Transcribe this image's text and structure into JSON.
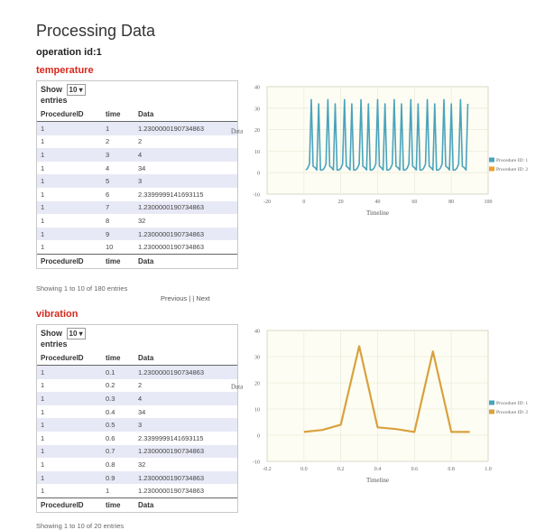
{
  "page": {
    "title": "Processing Data",
    "operation_label": "operation id:1"
  },
  "sections": [
    {
      "name": "temperature",
      "show_label": "Show",
      "entries_count": "10",
      "entries_label": "entries",
      "columns": [
        "ProcedureID",
        "time",
        "Data"
      ],
      "rows": [
        [
          "1",
          "1",
          "1.2300000190734863"
        ],
        [
          "1",
          "2",
          "2"
        ],
        [
          "1",
          "3",
          "4"
        ],
        [
          "1",
          "4",
          "34"
        ],
        [
          "1",
          "5",
          "3"
        ],
        [
          "1",
          "6",
          "2.3399999141693115"
        ],
        [
          "1",
          "7",
          "1.2300000190734863"
        ],
        [
          "1",
          "8",
          "32"
        ],
        [
          "1",
          "9",
          "1.2300000190734863"
        ],
        [
          "1",
          "10",
          "1.2300000190734863"
        ]
      ],
      "info": "Showing 1 to 10 of 180 entries",
      "pager": "Previous |  | Next"
    },
    {
      "name": "vibration",
      "show_label": "Show",
      "entries_count": "10",
      "entries_label": "entries",
      "columns": [
        "ProcedureID",
        "time",
        "Data"
      ],
      "rows": [
        [
          "1",
          "0.1",
          "1.2300000190734863"
        ],
        [
          "1",
          "0.2",
          "2"
        ],
        [
          "1",
          "0.3",
          "4"
        ],
        [
          "1",
          "0.4",
          "34"
        ],
        [
          "1",
          "0.5",
          "3"
        ],
        [
          "1",
          "0.6",
          "2.3399999141693115"
        ],
        [
          "1",
          "0.7",
          "1.2300000190734863"
        ],
        [
          "1",
          "0.8",
          "32"
        ],
        [
          "1",
          "0.9",
          "1.2300000190734863"
        ],
        [
          "1",
          "1",
          "1.2300000190734863"
        ]
      ],
      "info": "Showing 1 to 10 of 20 entries",
      "pager": ""
    }
  ],
  "chart_data": [
    {
      "type": "line",
      "xlabel": "Timeline",
      "ylabel": "Data",
      "xlim": [
        -20,
        100
      ],
      "ylim": [
        -10,
        40
      ],
      "xticks": [
        "-20",
        "0",
        "20",
        "40",
        "60",
        "80",
        "100"
      ],
      "yticks": [
        "-10",
        "0",
        "10",
        "20",
        "30",
        "40"
      ],
      "legend": "right",
      "series": [
        {
          "name": "Procedure ID: 1",
          "color": "#4aa3bd",
          "pattern": [
            1.23,
            2,
            4,
            34,
            3,
            2.34,
            1.23,
            32,
            1.23
          ],
          "x_start": 1,
          "x_end": 89
        },
        {
          "name": "Procedure ID: 2",
          "color": "#f0a02a"
        }
      ]
    },
    {
      "type": "line",
      "xlabel": "Timeline",
      "ylabel": "Data",
      "xlim": [
        -0.2,
        1.0
      ],
      "ylim": [
        -10,
        40
      ],
      "xticks": [
        "-0.2",
        "0.0",
        "0.2",
        "0.4",
        "0.6",
        "0.8",
        "1.0"
      ],
      "yticks": [
        "-10",
        "0",
        "10",
        "20",
        "30",
        "40"
      ],
      "legend": "right",
      "series": [
        {
          "name": "Procedure ID: 1",
          "color": "#4aa3bd"
        },
        {
          "name": "Procedure ID: 2",
          "color": "#d9a13e",
          "x": [
            0.0,
            0.1,
            0.2,
            0.3,
            0.4,
            0.5,
            0.6,
            0.7,
            0.8,
            0.9
          ],
          "y": [
            1.23,
            2,
            4,
            34,
            3,
            2.34,
            1.23,
            32,
            1.23,
            1.23
          ]
        }
      ]
    }
  ]
}
